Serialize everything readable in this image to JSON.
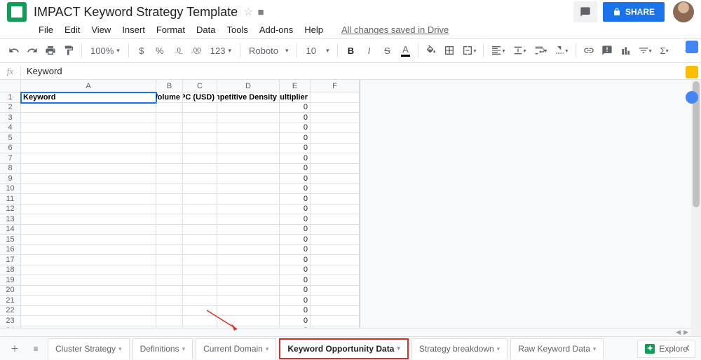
{
  "doc": {
    "title": "IMPACT Keyword Strategy Template",
    "save_status": "All changes saved in Drive"
  },
  "share": {
    "label": "SHARE"
  },
  "menu": {
    "file": "File",
    "edit": "Edit",
    "view": "View",
    "insert": "Insert",
    "format": "Format",
    "data": "Data",
    "tools": "Tools",
    "addons": "Add-ons",
    "help": "Help"
  },
  "toolbar": {
    "zoom": "100%",
    "currency": "$",
    "percent": "%",
    "dec_dec": ".0",
    "dec_inc": ".00",
    "numfmt": "123",
    "font": "Roboto",
    "fontsize": "10",
    "bold": "B",
    "italic": "I",
    "strike": "S",
    "underline_a": "A"
  },
  "fx": {
    "value": "Keyword"
  },
  "columns": {
    "A": {
      "label": "A",
      "width": 193
    },
    "B": {
      "label": "B",
      "width": 38
    },
    "C": {
      "label": "C",
      "width": 49
    },
    "D": {
      "label": "D",
      "width": 89
    },
    "E": {
      "label": "E",
      "width": 44
    },
    "F": {
      "label": "F",
      "width": 70
    }
  },
  "headers": {
    "A": "Keyword",
    "B": "Volume",
    "C": "CPC (USD)",
    "D": "Competitive Density",
    "E": "Multiplier"
  },
  "rows_shown": 25,
  "default_e": "0",
  "tabs": [
    {
      "label": "Cluster Strategy",
      "active": false
    },
    {
      "label": "Definitions",
      "active": false
    },
    {
      "label": "Current Domain",
      "active": false
    },
    {
      "label": "Keyword Opportunity Data",
      "active": true
    },
    {
      "label": "Strategy breakdown",
      "active": false
    },
    {
      "label": "Raw Keyword Data",
      "active": false
    }
  ],
  "explore": {
    "label": "Explore"
  }
}
